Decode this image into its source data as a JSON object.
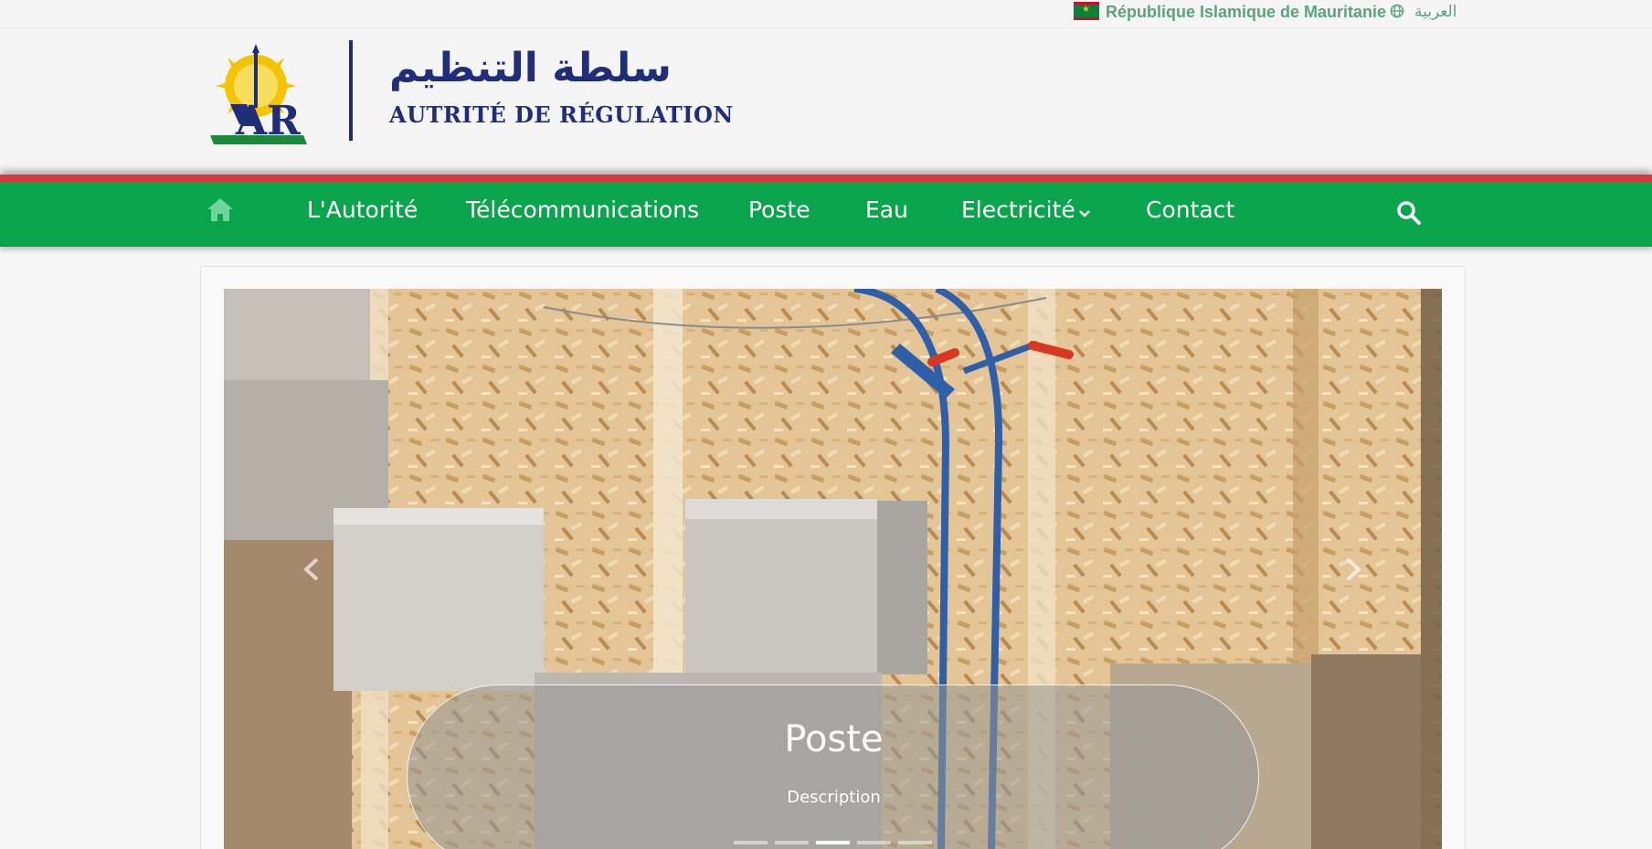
{
  "topbar": {
    "country": "République Islamique de Mauritanie",
    "language_link": "العربية",
    "flag_icon": "mauritania-flag-icon",
    "globe_icon": "globe-icon"
  },
  "header": {
    "logo_arabic": "سلطة التنظيم",
    "logo_french": "AUTRITÉ DE RÉGULATION"
  },
  "nav": {
    "home_icon": "home-icon",
    "items": [
      {
        "label": "L'Autorité"
      },
      {
        "label": "Télécommunications"
      },
      {
        "label": "Poste"
      },
      {
        "label": "Eau"
      },
      {
        "label": "Electricité"
      },
      {
        "label": "Contact"
      }
    ],
    "search_icon": "search-icon"
  },
  "carousel": {
    "caption_title": "Poste",
    "caption_description": "Description",
    "slide_count": 5,
    "active_slide": 3
  },
  "colors": {
    "nav_green": "#0aa44d",
    "accent_red": "#d9373f",
    "brand_navy": "#1f2d7a",
    "link_green": "#5aa37e"
  }
}
